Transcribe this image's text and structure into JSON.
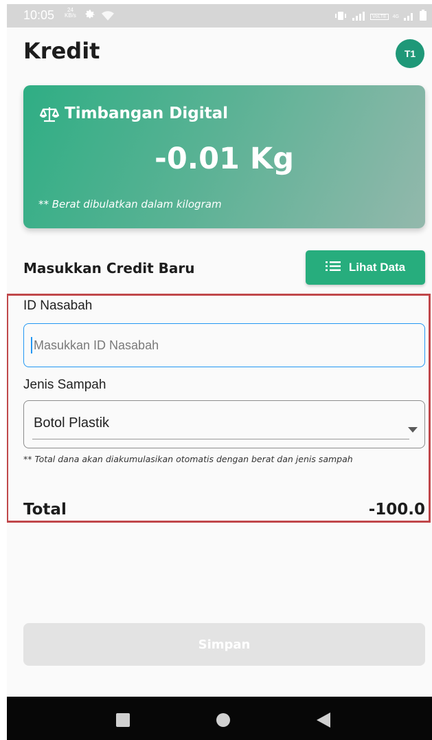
{
  "status_bar": {
    "time": "10:05",
    "speed_value": "24",
    "speed_unit": "KB/s",
    "volte": "VoLTE",
    "network": "4G"
  },
  "header": {
    "title": "Kredit",
    "avatar_initials": "T1"
  },
  "scale": {
    "title": "Timbangan Digital",
    "icon": "scale-balance-icon",
    "weight": "-0.01 Kg",
    "note": "** Berat dibulatkan dalam kilogram"
  },
  "form": {
    "section_title": "Masukkan Credit Baru",
    "lihat_data_label": "Lihat Data",
    "id_label": "ID Nasabah",
    "id_placeholder": "Masukkan ID Nasabah",
    "id_value": "",
    "jenis_label": "Jenis Sampah",
    "jenis_selected": "Botol Plastik",
    "hint": "** Total dana akan diakumulasikan otomatis dengan berat dan jenis sampah",
    "total_label": "Total",
    "total_value": "-100.0",
    "save_label": "Simpan"
  },
  "colors": {
    "primary_green": "#27ad7d",
    "avatar_green": "#1f9878",
    "focus_blue": "#2196f3",
    "disabled_gray": "#e3e3e3",
    "highlight_red": "#c0474a"
  }
}
